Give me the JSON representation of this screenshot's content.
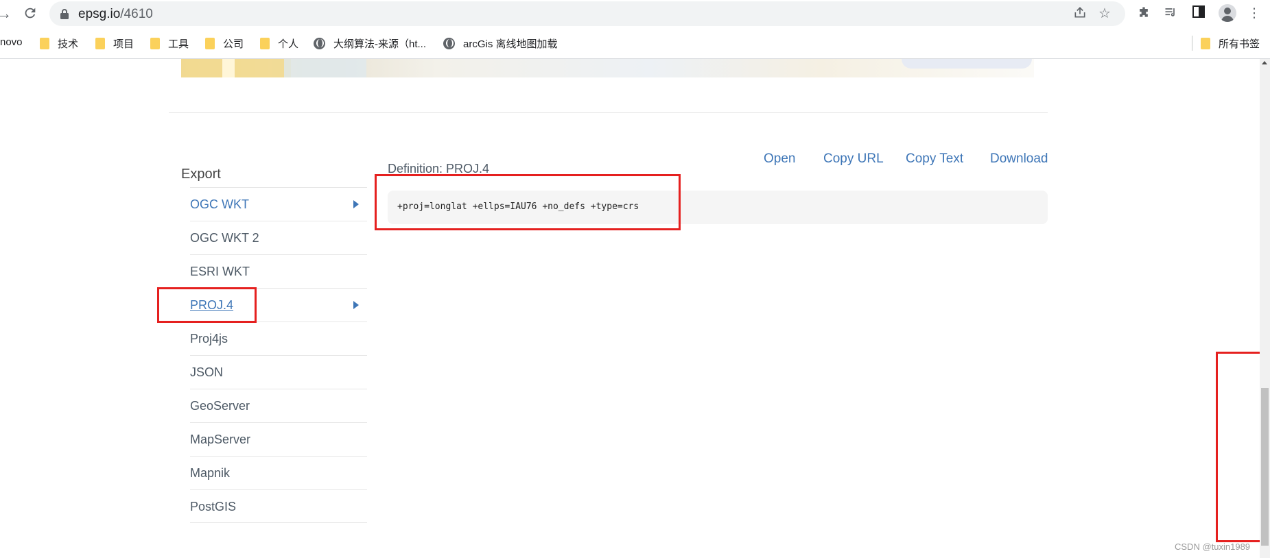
{
  "browser": {
    "url_host": "epsg.io",
    "url_path": "/4610",
    "back_icon": "arrow-right-icon",
    "reload_icon": "reload-icon",
    "toolbar_icons": [
      "share-icon",
      "bookmark-star-icon",
      "extensions-icon",
      "reading-list-icon",
      "side-panel-icon",
      "profile-icon",
      "menu-dots-icon"
    ]
  },
  "bookmarks": {
    "items": [
      {
        "label": "novo",
        "icon": "none"
      },
      {
        "label": "技术",
        "icon": "folder-icon"
      },
      {
        "label": "项目",
        "icon": "folder-icon"
      },
      {
        "label": "工具",
        "icon": "folder-icon"
      },
      {
        "label": "公司",
        "icon": "folder-icon"
      },
      {
        "label": "个人",
        "icon": "folder-icon"
      },
      {
        "label": "大纲算法-来源（ht...",
        "icon": "globe-icon"
      },
      {
        "label": "arcGis 离线地图加载",
        "icon": "globe-icon"
      }
    ],
    "all_bookmarks": "所有书签"
  },
  "export": {
    "title": "Export",
    "items": [
      {
        "label": "OGC WKT"
      },
      {
        "label": "OGC WKT 2"
      },
      {
        "label": "ESRI WKT"
      },
      {
        "label": "PROJ.4"
      },
      {
        "label": "Proj4js"
      },
      {
        "label": "JSON"
      },
      {
        "label": "GeoServer"
      },
      {
        "label": "MapServer"
      },
      {
        "label": "Mapnik"
      },
      {
        "label": "PostGIS"
      }
    ],
    "selected": "PROJ.4"
  },
  "definition": {
    "title": "Definition: PROJ.4",
    "actions": {
      "open": "Open",
      "copy_url": "Copy URL",
      "copy_text": "Copy Text",
      "download": "Download"
    },
    "code": "+proj=longlat +ellps=IAU76 +no_defs +type=crs"
  },
  "highlight_color": "#e5201f",
  "link_color": "#3e76b7",
  "watermark": "CSDN @tuxin1989"
}
